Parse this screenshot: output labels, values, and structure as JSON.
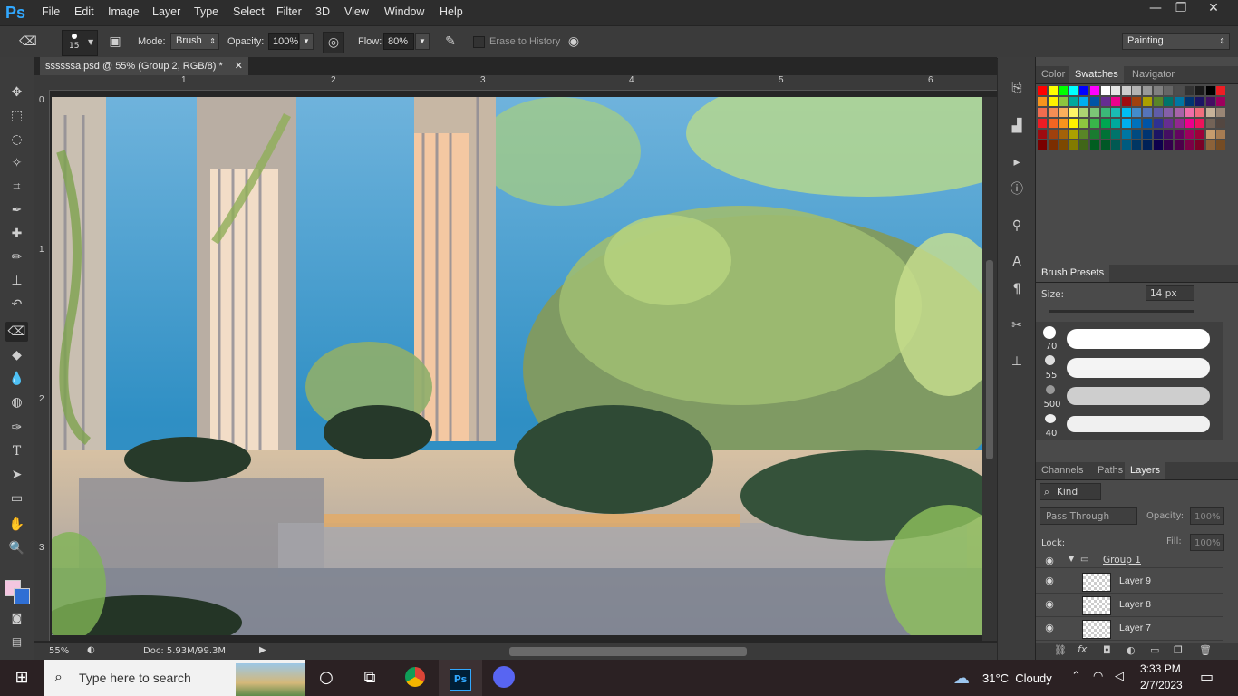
{
  "app": {
    "logo": "Ps"
  },
  "menu": [
    "File",
    "Edit",
    "Image",
    "Layer",
    "Type",
    "Select",
    "Filter",
    "3D",
    "View",
    "Window",
    "Help"
  ],
  "window_controls": {
    "minimize": "—",
    "restore": "❐",
    "close": "✕"
  },
  "options": {
    "brush_size": "15",
    "mode_label": "Mode:",
    "mode_value": "Brush",
    "opacity_label": "Opacity:",
    "opacity_value": "100%",
    "flow_label": "Flow:",
    "flow_value": "80%",
    "erase_history": "Erase to History",
    "workspace": "Painting"
  },
  "document": {
    "tab_title": "ssssssa.psd @ 55% (Group 2, RGB/8) *",
    "ruler_top": [
      "1",
      "2",
      "3",
      "4",
      "5",
      "6"
    ],
    "ruler_left": [
      "0",
      "1",
      "2",
      "3"
    ],
    "zoom": "55%",
    "doc_size": "Doc: 5.93M/99.3M"
  },
  "panels": {
    "color_tabs": [
      "Color",
      "Swatches",
      "Navigator"
    ],
    "brush_presets": {
      "title": "Brush Presets",
      "size_label": "Size:",
      "size_value": "14 px",
      "sizes": [
        "70",
        "55",
        "500",
        "40"
      ]
    },
    "layers": {
      "tabs": [
        "Channels",
        "Paths",
        "Layers"
      ],
      "kind": "Kind",
      "blend": "Pass Through",
      "opacity_label": "Opacity:",
      "opacity_value": "100%",
      "lock_label": "Lock:",
      "fill_label": "Fill:",
      "fill_value": "100%",
      "group": "Group 1",
      "items": [
        "Layer 9",
        "Layer 8",
        "Layer 7"
      ]
    }
  },
  "taskbar": {
    "search_placeholder": "Type here to search",
    "weather": "31°C  Cloudy",
    "time": "3:33 PM",
    "date": "2/7/2023"
  },
  "colors": {
    "foreground": "#f3c6e0",
    "background": "#2f6fd4",
    "ps_blue": "#31a8ff"
  }
}
